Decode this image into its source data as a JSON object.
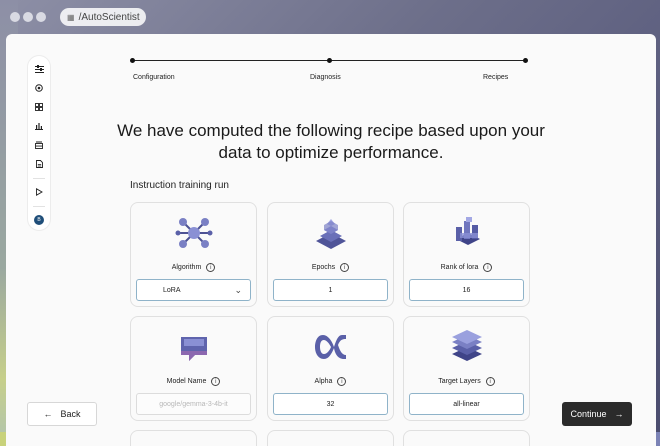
{
  "browser": {
    "url": "/AutoScientist"
  },
  "stepper": {
    "steps": [
      "Configuration",
      "Diagnosis",
      "Recipes"
    ]
  },
  "headline": "We have computed the following recipe based upon your data to optimize performance.",
  "section_label": "Instruction training run",
  "sidebar": {
    "avatar_initial": "B",
    "icons": [
      "sliders-icon",
      "target-icon",
      "grid-icon",
      "bar-chart-icon",
      "layers-icon",
      "document-icon",
      "play-icon"
    ]
  },
  "cards": [
    {
      "label": "Algorithm",
      "value": "LoRA",
      "kind": "select"
    },
    {
      "label": "Epochs",
      "value": "1",
      "kind": "input"
    },
    {
      "label": "Rank of lora",
      "value": "16",
      "kind": "input"
    },
    {
      "label": "Model Name",
      "placeholder": "google/gemma-3-4b-it",
      "kind": "disabled"
    },
    {
      "label": "Alpha",
      "value": "32",
      "kind": "input"
    },
    {
      "label": "Target Layers",
      "value": "all-linear",
      "kind": "input"
    }
  ],
  "buttons": {
    "back": "Back",
    "continue": "Continue"
  },
  "colors": {
    "accent_border": "#8fb3c9",
    "primary_button": "#2b2b2b",
    "illustration": "#6f74b8"
  }
}
